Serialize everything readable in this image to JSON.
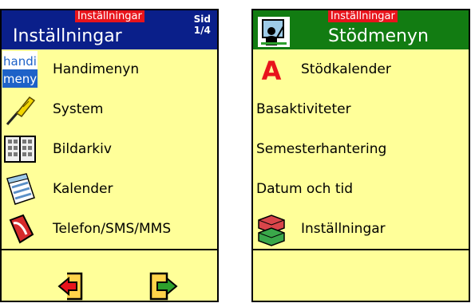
{
  "left_panel": {
    "header_tag": "Inställningar",
    "title": "Inställningar",
    "page_label": "Sid",
    "page_value": "1/4",
    "items": [
      {
        "label": "Handimenyn",
        "icon_text_top": "handi",
        "icon_text_bottom": "meny"
      },
      {
        "label": "System"
      },
      {
        "label": "Bildarkiv"
      },
      {
        "label": "Kalender"
      },
      {
        "label": "Telefon/SMS/MMS"
      }
    ]
  },
  "right_panel": {
    "header_tag": "Inställningar",
    "title": "Stödmenyn",
    "items": [
      {
        "label": "Stödkalender",
        "icon_letter": "A"
      },
      {
        "label": "Basaktiviteter"
      },
      {
        "label": "Semesterhantering"
      },
      {
        "label": "Datum och tid"
      },
      {
        "label": "Inställningar"
      }
    ]
  },
  "colors": {
    "left_header": "#0a1f8a",
    "right_header": "#127c12",
    "item_background": "#ffff99",
    "tag_red": "#e8141c"
  },
  "icons": {
    "handimenyn": "handimeny-logo-icon",
    "system": "screwdriver-icon",
    "bildarkiv": "photo-album-icon",
    "kalender": "calendar-icon",
    "telefon": "phone-icon",
    "stodmenyn": "person-board-icon",
    "stodkalender": "letter-a-icon",
    "installningar": "building-blocks-icon",
    "nav_back": "exit-back-icon",
    "nav_forward": "enter-forward-icon"
  }
}
